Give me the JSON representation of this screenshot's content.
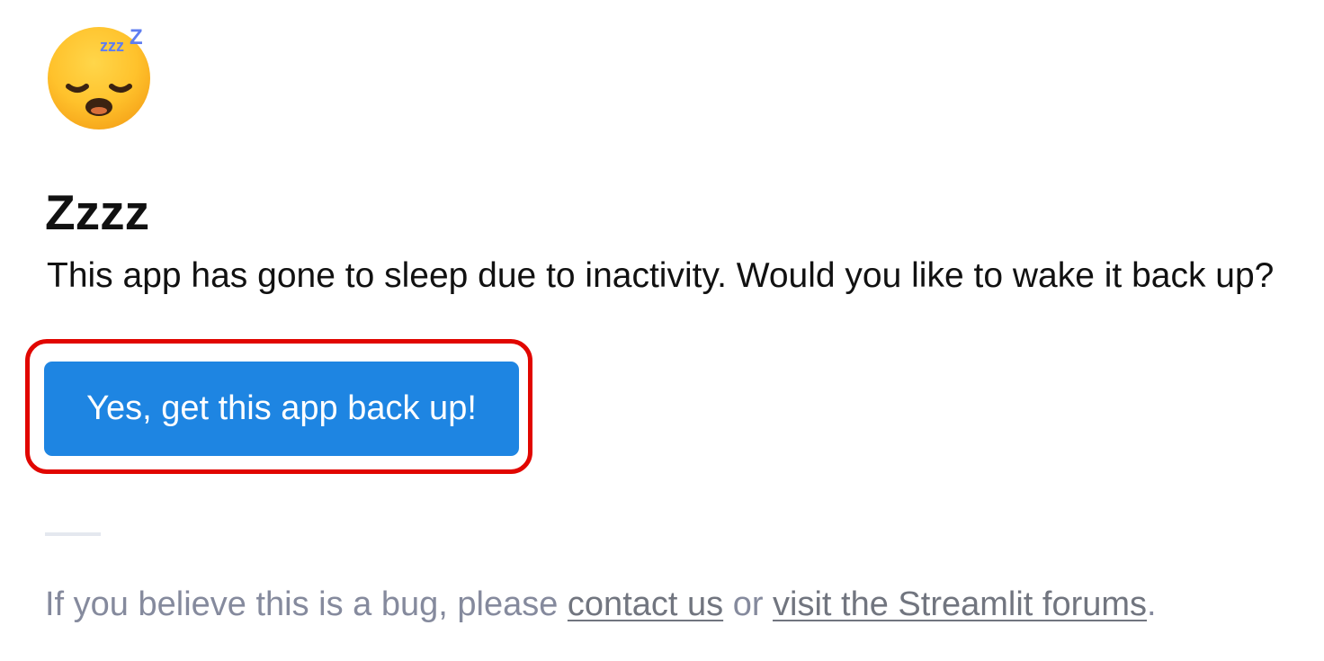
{
  "emoji": {
    "icon": "sleeping-face-icon",
    "zzz": "zzz"
  },
  "title": "Zzzz",
  "message": "This app has gone to sleep due to inactivity. Would you like to wake it back up?",
  "button": {
    "label": "Yes, get this app back up!",
    "color": "#1e85e2"
  },
  "highlight": {
    "color": "#e10600"
  },
  "footer": {
    "prefix": "If you believe this is a bug, please ",
    "contact_link": "contact us",
    "middle": " or ",
    "forums_link": "visit the Streamlit forums",
    "suffix": "."
  }
}
